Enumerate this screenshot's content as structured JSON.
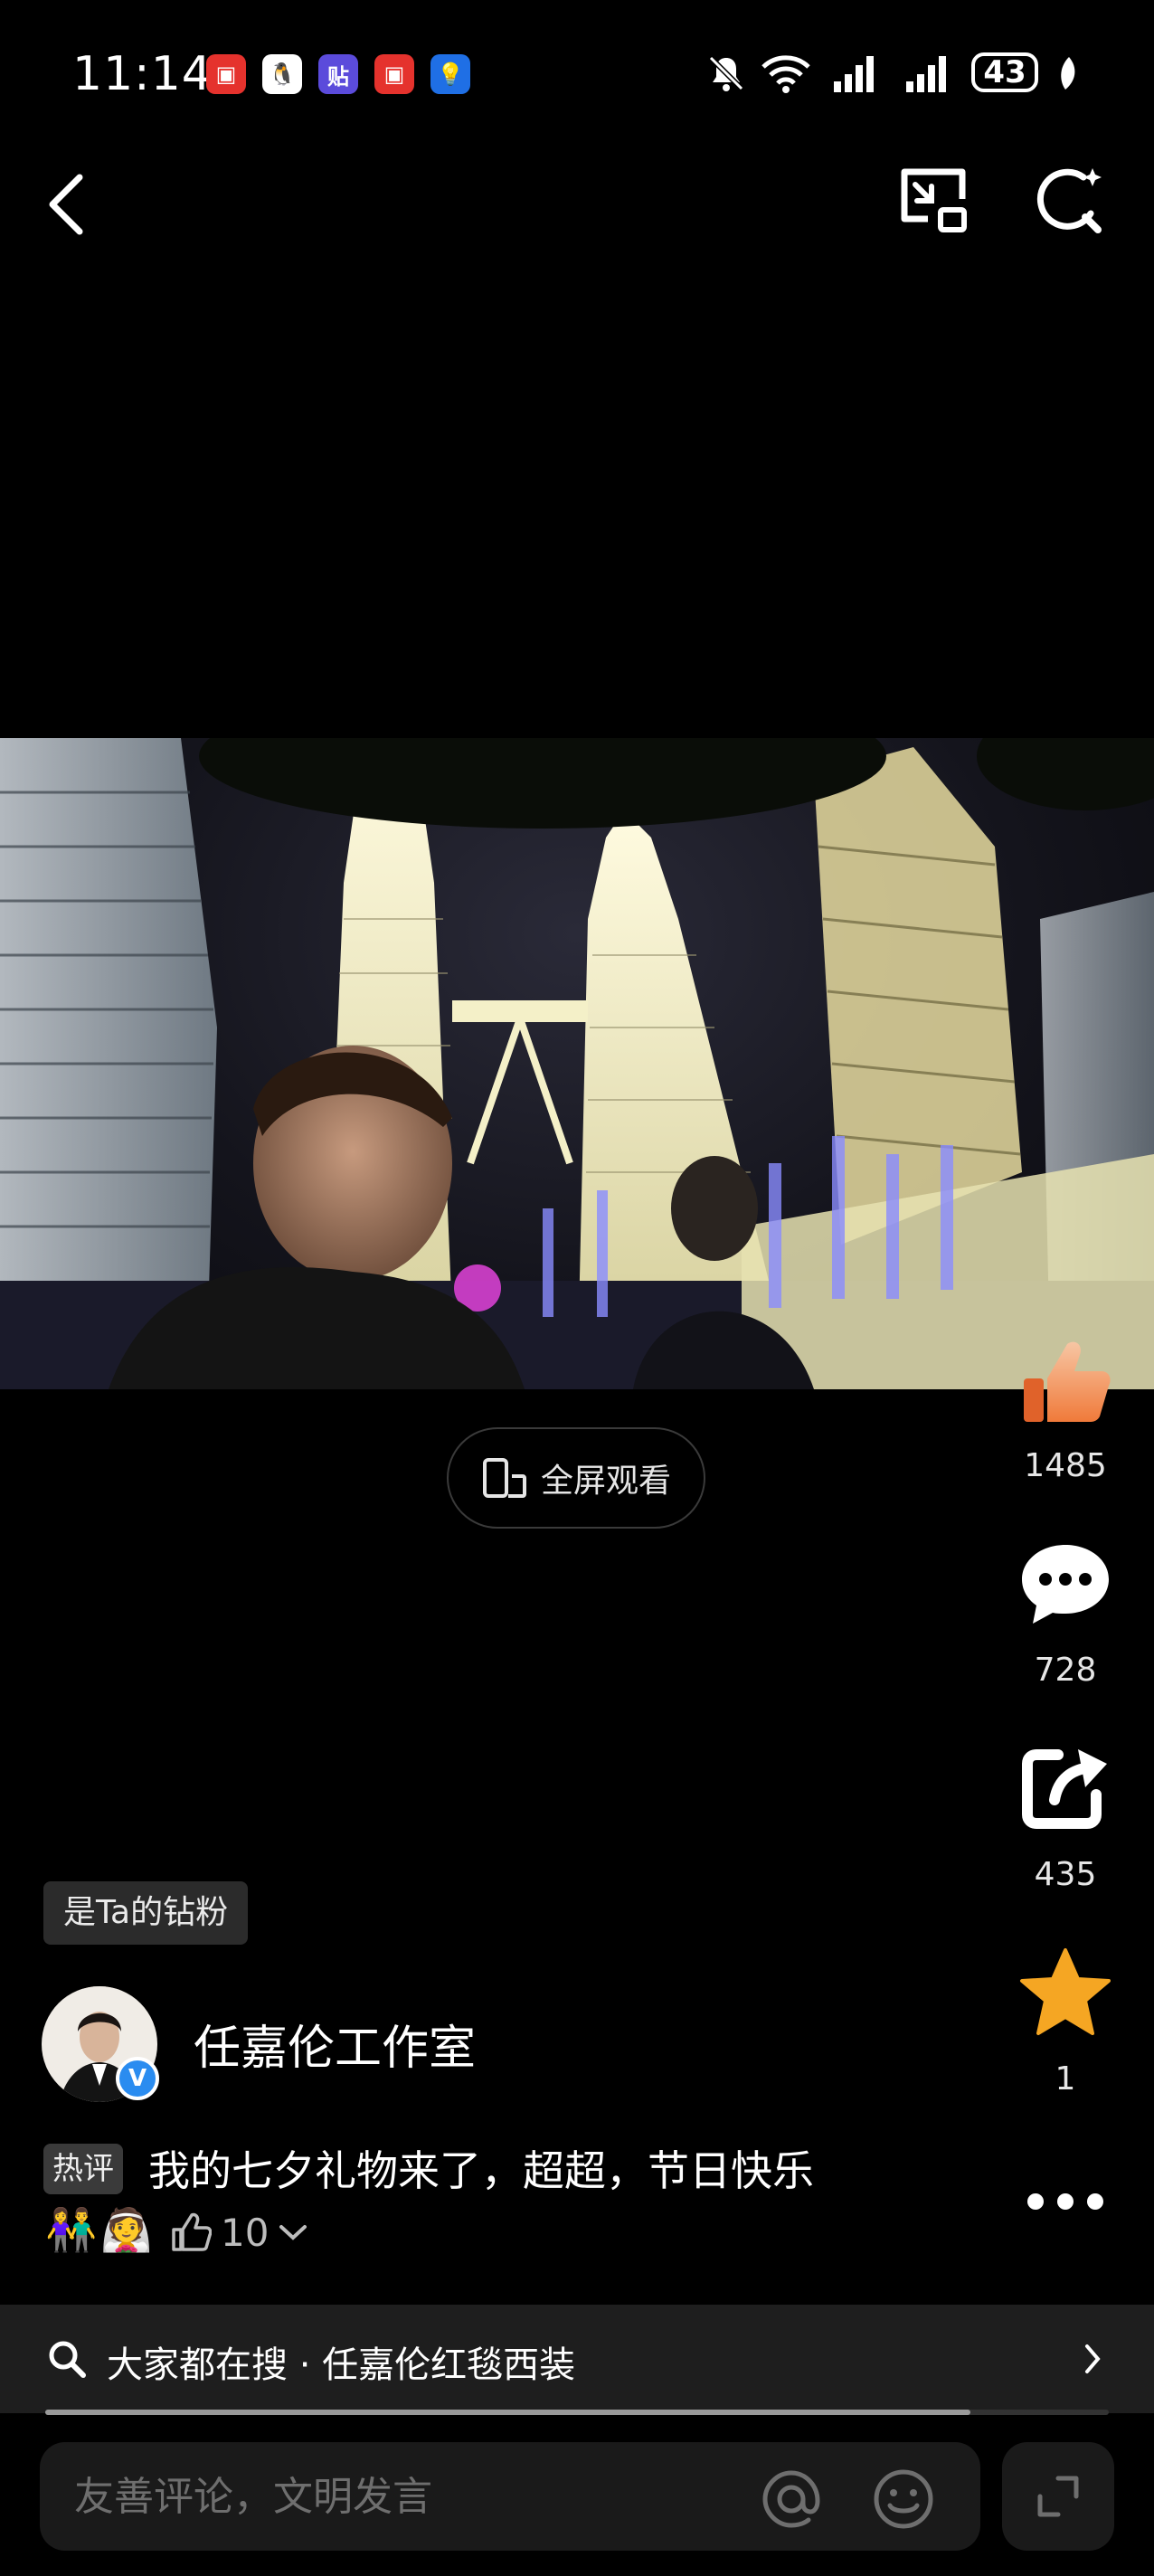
{
  "status_bar": {
    "time": "11:14",
    "battery_level": "43",
    "apps": [
      {
        "name": "red-reader-app-icon",
        "glyph": "▣",
        "color": "#e5322d"
      },
      {
        "name": "qq-app-icon",
        "glyph": "🐧",
        "color": "#ffffff"
      },
      {
        "name": "tieba-app-icon",
        "glyph": "贴",
        "color": "#5b4bdb"
      },
      {
        "name": "red-reader-app-icon-2",
        "glyph": "▣",
        "color": "#e5322d"
      },
      {
        "name": "bulb-app-icon",
        "glyph": "💡",
        "color": "#1f6fe5"
      }
    ]
  },
  "fullscreen": {
    "label": "全屏观看"
  },
  "actions": {
    "like_count": "1485",
    "comment_count": "728",
    "share_count": "435",
    "favorite_count": "1"
  },
  "author": {
    "fan_badge": "是Ta的钻粉",
    "name": "任嘉伦工作室"
  },
  "hot_comment": {
    "tag": "热评",
    "text": "我的七夕礼物来了，超超，节日快乐",
    "emojis": [
      "👫",
      "👰"
    ],
    "like_count": "10"
  },
  "hot_search": {
    "text": "大家都在搜 · 任嘉伦红毯西装",
    "progress": 0.87
  },
  "comment_input": {
    "placeholder": "友善评论，文明发言"
  },
  "colors": {
    "like_gradient_top": "#f7c6a4",
    "like_gradient_bottom": "#f07a3a",
    "star": "#f5a623",
    "verified": "#2a8cf0"
  }
}
